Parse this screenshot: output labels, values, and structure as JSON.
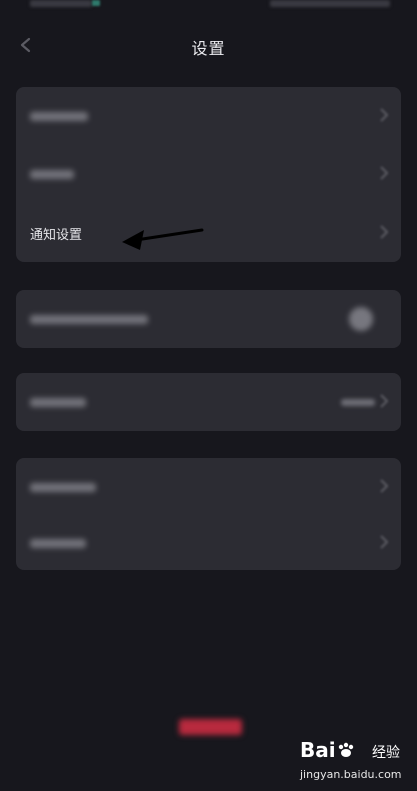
{
  "header": {
    "title": "设置"
  },
  "groups": {
    "notification_label": "通知设置"
  },
  "watermark": {
    "brand_a": "Bai",
    "brand_b": "经验",
    "url": "jingyan.baidu.com"
  },
  "icons": {
    "back": "back-arrow-icon",
    "chevron": "chevron-right-icon",
    "annotation": "pointer-arrow-icon"
  },
  "colors": {
    "background": "#17171d",
    "card": "#2c2c33",
    "danger_button": "#b82a3e"
  }
}
